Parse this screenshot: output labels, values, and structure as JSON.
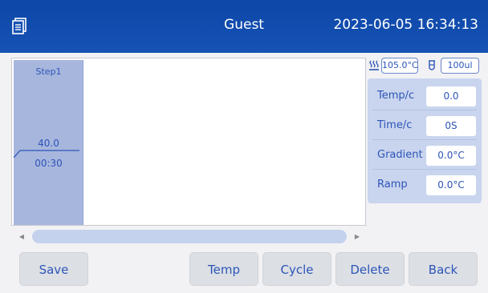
{
  "header": {
    "user": "Guest",
    "datetime": "2023-06-05 16:34:13",
    "menu_icon": "document-list-icon"
  },
  "program": {
    "steps": [
      {
        "title": "Step1",
        "temperature": "40.0",
        "time": "00:30"
      }
    ]
  },
  "status": {
    "lid_temp": "105.0°C",
    "volume": "100ul",
    "lid_icon": "heated-lid-icon",
    "volume_icon": "tube-icon"
  },
  "params": [
    {
      "label": "Temp/c",
      "value": "0.0"
    },
    {
      "label": "Time/c",
      "value": "0S"
    },
    {
      "label": "Gradient",
      "value": "0.0°C"
    },
    {
      "label": "Ramp",
      "value": "0.0°C"
    }
  ],
  "buttons": {
    "save": "Save",
    "temp": "Temp",
    "cycle": "Cycle",
    "delete": "Delete",
    "back": "Back"
  },
  "scroll": {
    "left_icon": "scroll-left-icon",
    "right_icon": "scroll-right-icon"
  },
  "colors": {
    "header": "#1652b4",
    "accent": "#2d55b8",
    "step_bg": "#a7b6dd",
    "panel_bg": "#c9d5ee"
  }
}
